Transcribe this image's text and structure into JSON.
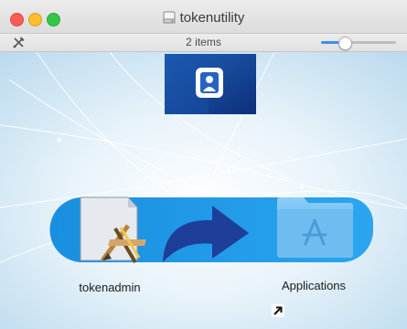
{
  "window": {
    "title": "tokenutility",
    "item_count": "2 items",
    "icon_size_level": 0.32
  },
  "items": [
    {
      "name": "tokenadmin",
      "kind": "application"
    },
    {
      "name": "Applications",
      "kind": "folder-alias"
    }
  ],
  "colors": {
    "background_light": "#dcecf5",
    "banner_blue": "#1f9be6",
    "arrow_blue": "#1d3f99",
    "folder_blue": "#5cb4ec"
  },
  "icons": [
    "disk-icon",
    "tools-icon",
    "token-logo-icon",
    "app-icon",
    "arrow-icon",
    "folder-icon",
    "alias-arrow-icon"
  ]
}
